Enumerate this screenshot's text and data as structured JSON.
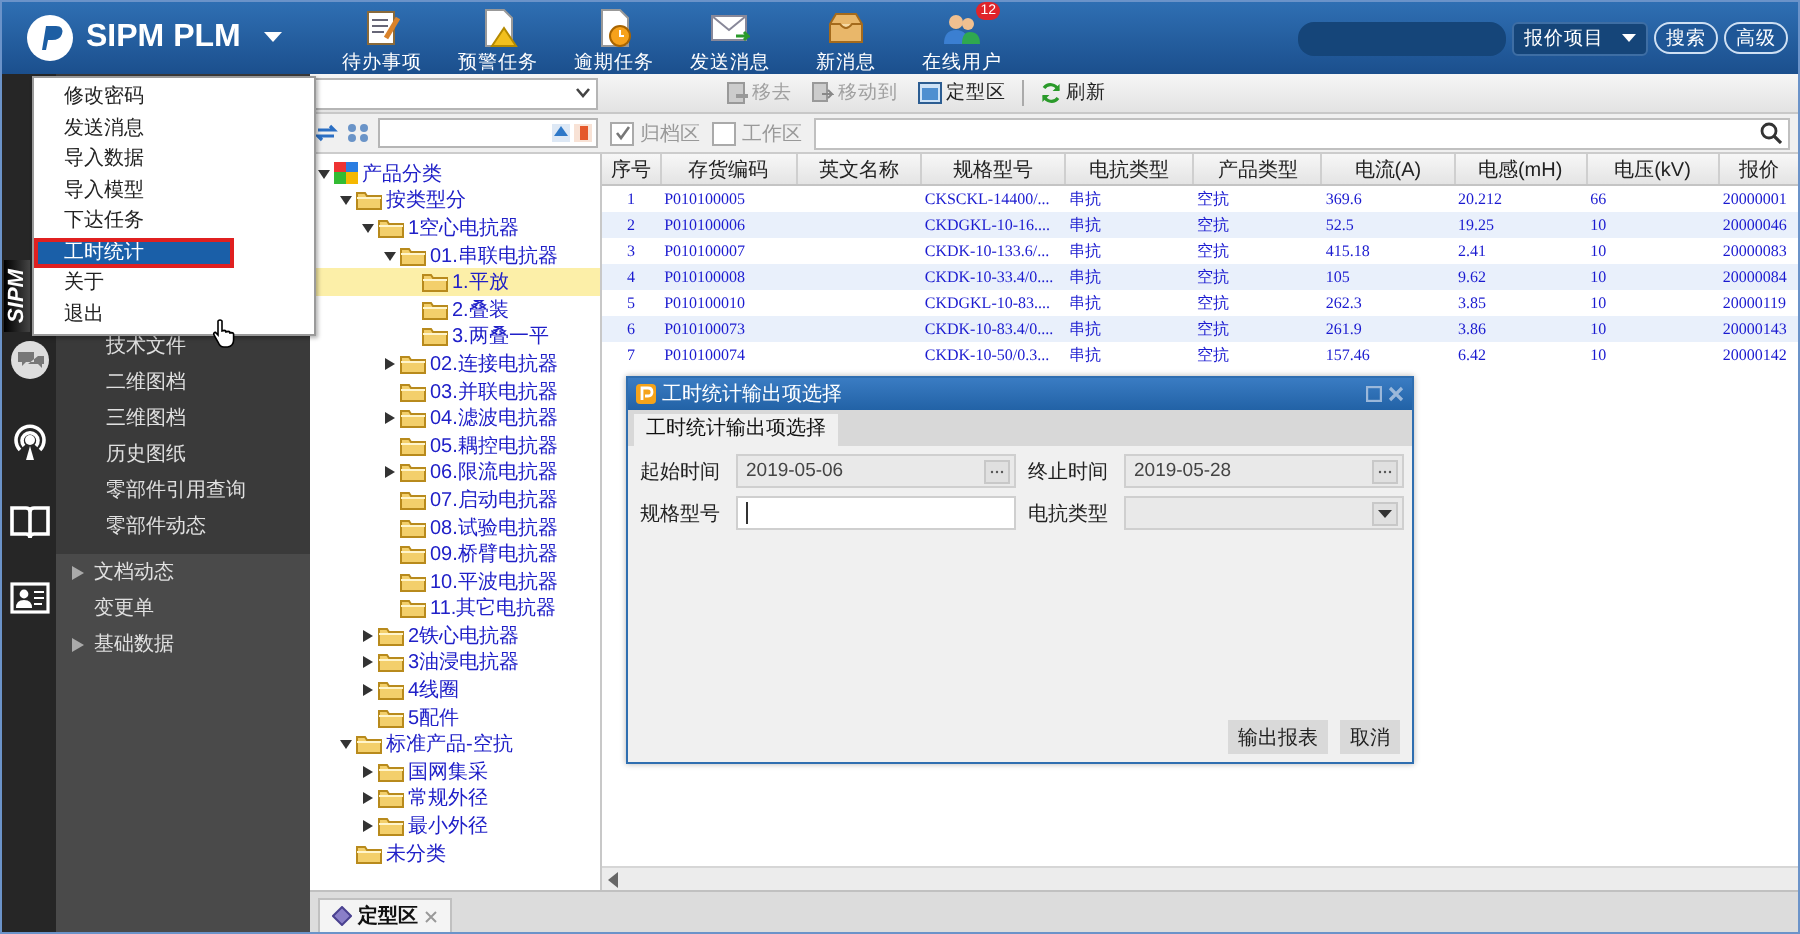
{
  "app": {
    "title": "SIPM PLM"
  },
  "toolbar": [
    {
      "label": "待办事项",
      "kind": "todo"
    },
    {
      "label": "预警任务",
      "kind": "warning"
    },
    {
      "label": "逾期任务",
      "kind": "overdue"
    },
    {
      "label": "发送消息",
      "kind": "send"
    },
    {
      "label": "新消息",
      "kind": "inbox"
    },
    {
      "label": "在线用户",
      "kind": "users",
      "badge": "12"
    }
  ],
  "search": {
    "scope": "报价项目",
    "buttons": [
      "搜索",
      "高级"
    ]
  },
  "sidebar": {
    "brand_label": "SIPM",
    "items": [
      {
        "label": "技术文件",
        "kind": "sub"
      },
      {
        "label": "二维图档",
        "kind": "sub"
      },
      {
        "label": "三维图档",
        "kind": "sub"
      },
      {
        "label": "历史图纸",
        "kind": "sub"
      },
      {
        "label": "零部件引用查询",
        "kind": "sub"
      },
      {
        "label": "零部件动态",
        "kind": "sub"
      },
      {
        "label": "文档动态",
        "kind": "group",
        "expanded": false
      },
      {
        "label": "变更单",
        "kind": "group"
      },
      {
        "label": "基础数据",
        "kind": "group",
        "expanded": false
      }
    ]
  },
  "user_menu": {
    "items": [
      {
        "label": "修改密码",
        "selected": false
      },
      {
        "label": "发送消息",
        "selected": false
      },
      {
        "label": "导入数据",
        "selected": false
      },
      {
        "label": "导入模型",
        "selected": false
      },
      {
        "label": "下达任务",
        "selected": false
      },
      {
        "label": "工时统计",
        "selected": true
      },
      {
        "label": "关于",
        "selected": false
      },
      {
        "label": "退出",
        "selected": false
      }
    ]
  },
  "actions": [
    {
      "label": "移去",
      "kind": "remove",
      "disabled": true
    },
    {
      "label": "移动到",
      "kind": "move",
      "disabled": true
    },
    {
      "label": "定型区",
      "kind": "area",
      "disabled": false
    },
    {
      "label": "刷新",
      "kind": "refresh",
      "disabled": false
    }
  ],
  "filters": [
    {
      "label": "归档区",
      "checked": true
    },
    {
      "label": "工作区",
      "checked": false
    }
  ],
  "tree": {
    "nodes": [
      {
        "label": "产品分类",
        "selected": false,
        "expanded": true,
        "children": [
          {
            "label": "按类型分",
            "selected": false,
            "expanded": true,
            "children": [
              {
                "label": "1空心电抗器",
                "selected": false,
                "expanded": true,
                "children": [
                  {
                    "label": "01.串联电抗器",
                    "selected": false,
                    "expanded": true,
                    "children": [
                      {
                        "label": "1.平放",
                        "selected": true
                      },
                      {
                        "label": "2.叠装",
                        "selected": false
                      },
                      {
                        "label": "3.两叠一平",
                        "selected": false
                      }
                    ]
                  },
                  {
                    "label": "02.连接电抗器",
                    "selected": false,
                    "expanded": false
                  },
                  {
                    "label": "03.并联电抗器",
                    "selected": false
                  },
                  {
                    "label": "04.滤波电抗器",
                    "selected": false,
                    "expanded": false
                  },
                  {
                    "label": "05.耦控电抗器",
                    "selected": false
                  },
                  {
                    "label": "06.限流电抗器",
                    "selected": false,
                    "expanded": false
                  },
                  {
                    "label": "07.启动电抗器",
                    "selected": false
                  },
                  {
                    "label": "08.试验电抗器",
                    "selected": false
                  },
                  {
                    "label": "09.桥臂电抗器",
                    "selected": false
                  },
                  {
                    "label": "10.平波电抗器",
                    "selected": false
                  },
                  {
                    "label": "11.其它电抗器",
                    "selected": false
                  }
                ]
              },
              {
                "label": "2铁心电抗器",
                "selected": false,
                "expanded": false
              },
              {
                "label": "3油浸电抗器",
                "selected": false,
                "expanded": false
              },
              {
                "label": "4线圈",
                "selected": false,
                "expanded": false
              },
              {
                "label": "5配件",
                "selected": false
              }
            ]
          },
          {
            "label": "标准产品-空抗",
            "selected": false,
            "expanded": true,
            "children": [
              {
                "label": "国网集采",
                "selected": false,
                "expanded": false
              },
              {
                "label": "常规外径",
                "selected": false,
                "expanded": false
              },
              {
                "label": "最小外径",
                "selected": false,
                "expanded": false
              }
            ]
          },
          {
            "label": "未分类",
            "selected": false
          }
        ]
      }
    ]
  },
  "table": {
    "columns": [
      "序号",
      "存货编码",
      "英文名称",
      "规格型号",
      "电抗类型",
      "产品类型",
      "电流(A)",
      "电感(mH)",
      "电压(kV)",
      "报价"
    ],
    "rows": [
      {
        "no": "1",
        "code": "P010100005",
        "spec": "CKSCKL-14400/...",
        "reactor_type": "串抗",
        "product_type": "空抗",
        "current": "369.6",
        "inductance": "20.212",
        "voltage": "66",
        "quote_no": "20000001"
      },
      {
        "no": "2",
        "code": "P010100006",
        "spec": "CKDGKL-10-16....",
        "reactor_type": "串抗",
        "product_type": "空抗",
        "current": "52.5",
        "inductance": "19.25",
        "voltage": "10",
        "quote_no": "20000046"
      },
      {
        "no": "3",
        "code": "P010100007",
        "spec": "CKDK-10-133.6/...",
        "reactor_type": "串抗",
        "product_type": "空抗",
        "current": "415.18",
        "inductance": "2.41",
        "voltage": "10",
        "quote_no": "20000083"
      },
      {
        "no": "4",
        "code": "P010100008",
        "spec": "CKDK-10-33.4/0....",
        "reactor_type": "串抗",
        "product_type": "空抗",
        "current": "105",
        "inductance": "9.62",
        "voltage": "10",
        "quote_no": "20000084"
      },
      {
        "no": "5",
        "code": "P010100010",
        "spec": "CKDGKL-10-83....",
        "reactor_type": "串抗",
        "product_type": "空抗",
        "current": "262.3",
        "inductance": "3.85",
        "voltage": "10",
        "quote_no": "20000119"
      },
      {
        "no": "6",
        "code": "P010100073",
        "spec": "CKDK-10-83.4/0....",
        "reactor_type": "串抗",
        "product_type": "空抗",
        "current": "261.9",
        "inductance": "3.86",
        "voltage": "10",
        "quote_no": "20000143"
      },
      {
        "no": "7",
        "code": "P010100074",
        "spec": "CKDK-10-50/0.3...",
        "reactor_type": "串抗",
        "product_type": "空抗",
        "current": "157.46",
        "inductance": "6.42",
        "voltage": "10",
        "quote_no": "20000142"
      }
    ]
  },
  "dialog": {
    "title": "工时统计输出项选择",
    "tab": {
      "label": "工时统计输出项选择",
      "selected": true
    },
    "fields": [
      {
        "label": "起始时间",
        "kind": "date",
        "value": "2019-05-06"
      },
      {
        "label": "终止时间",
        "kind": "date",
        "value": "2019-05-28"
      },
      {
        "label": "规格型号",
        "kind": "text"
      },
      {
        "label": "电抗类型",
        "kind": "select"
      }
    ],
    "buttons": [
      "输出报表",
      "取消"
    ]
  },
  "bottom_tabs": [
    {
      "label": "定型区",
      "selected": true
    }
  ]
}
